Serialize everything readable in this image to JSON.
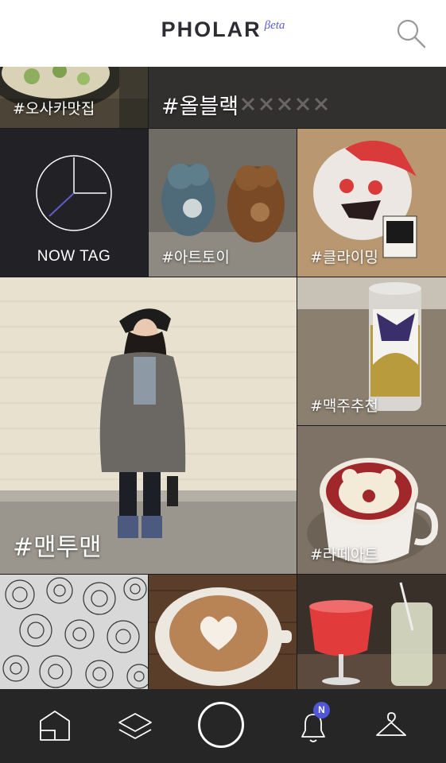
{
  "app": {
    "logo": "PHOLAR",
    "beta": "βeta"
  },
  "feed": {
    "row1": [
      {
        "tag": "#오사카맛집"
      },
      {
        "tag": "#올블랙"
      }
    ],
    "now_tag_label": "NOW TAG",
    "row2": [
      {
        "tag": "#아트토이"
      },
      {
        "tag": "#클라이밍"
      }
    ],
    "featured": {
      "tag": "#맨투맨"
    },
    "side": [
      {
        "tag": "#맥주추천"
      },
      {
        "tag": "#라떼아트"
      }
    ]
  },
  "bottom_nav": {
    "items": [
      "home-icon",
      "layers-icon",
      "camera-button",
      "bell-icon",
      "hanger-icon"
    ],
    "notification_badge": "N"
  },
  "colors": {
    "accent": "#5b5fc7",
    "badge": "#4f57d6",
    "bar": "#262626"
  }
}
